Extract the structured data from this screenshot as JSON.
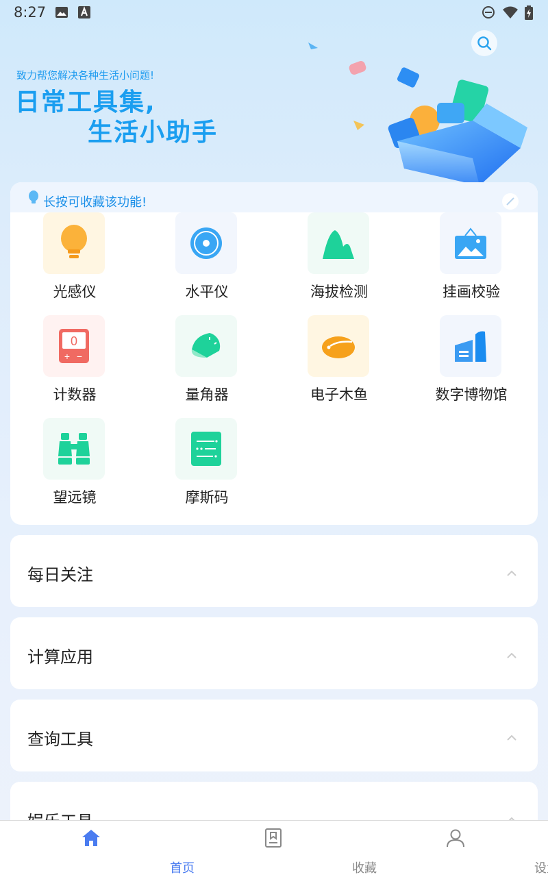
{
  "status_bar": {
    "time": "8:27",
    "icons": [
      "image-icon",
      "a-icon",
      "dnd-icon",
      "wifi-icon",
      "battery-icon"
    ]
  },
  "hero": {
    "subtitle": "致力帮您解决各种生活小问题!",
    "title_line1": "日常工具集,",
    "title_line2": "生活小助手"
  },
  "tip": {
    "text": "长按可收藏该功能!"
  },
  "tools": [
    {
      "label": "光感仪",
      "icon": "lightbulb-icon",
      "bg": "#fff6e2"
    },
    {
      "label": "水平仪",
      "icon": "level-icon",
      "bg": "#f2f6fd"
    },
    {
      "label": "海拔检测",
      "icon": "mountain-icon",
      "bg": "#f0faf6"
    },
    {
      "label": "挂画校验",
      "icon": "picture-frame-icon",
      "bg": "#f2f6fd"
    },
    {
      "label": "计数器",
      "icon": "counter-icon",
      "bg": "#fff2f1",
      "counter_value": "0"
    },
    {
      "label": "量角器",
      "icon": "protractor-icon",
      "bg": "#f0faf6"
    },
    {
      "label": "电子木鱼",
      "icon": "wooden-fish-icon",
      "bg": "#fff6e2"
    },
    {
      "label": "数字博物馆",
      "icon": "museum-icon",
      "bg": "#f2f6fd"
    },
    {
      "label": "望远镜",
      "icon": "binoculars-icon",
      "bg": "#f0faf6"
    },
    {
      "label": "摩斯码",
      "icon": "morse-code-icon",
      "bg": "#f0faf6"
    }
  ],
  "sections": [
    {
      "title": "每日关注"
    },
    {
      "title": "计算应用"
    },
    {
      "title": "查询工具"
    },
    {
      "title": "娱乐工具"
    }
  ],
  "nav": {
    "items": [
      {
        "label": "首页",
        "icon": "home-icon",
        "active": true
      },
      {
        "label": "收藏",
        "icon": "bookmark-icon",
        "active": false
      },
      {
        "label": "设置",
        "icon": "person-icon",
        "active": false
      }
    ]
  },
  "colors": {
    "accent": "#1a9ef0",
    "nav_active": "#4a7cf0",
    "nav_inactive": "#888888"
  }
}
